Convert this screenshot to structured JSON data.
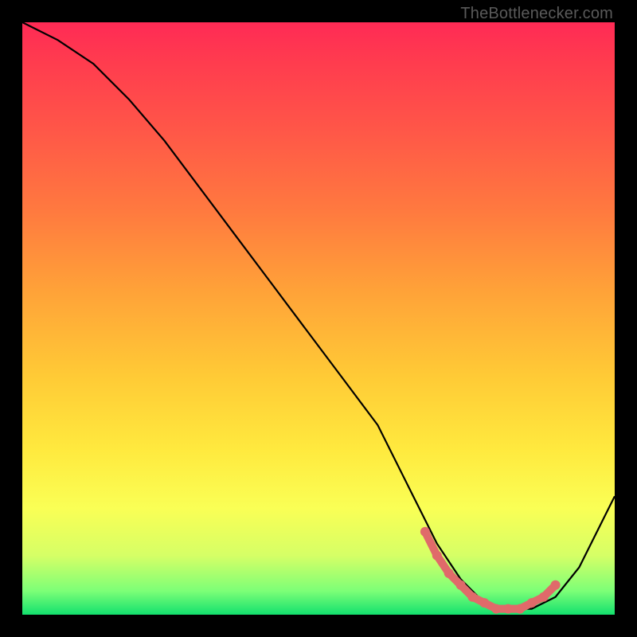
{
  "attribution": "TheBottlenecker.com",
  "chart_data": {
    "type": "line",
    "title": "",
    "xlabel": "",
    "ylabel": "",
    "xlim": [
      0,
      100
    ],
    "ylim": [
      0,
      100
    ],
    "series": [
      {
        "name": "bottleneck-curve",
        "x": [
          0,
          6,
          12,
          18,
          24,
          30,
          36,
          42,
          48,
          54,
          60,
          66,
          70,
          74,
          78,
          82,
          86,
          90,
          94,
          98,
          100
        ],
        "values": [
          100,
          97,
          93,
          87,
          80,
          72,
          64,
          56,
          48,
          40,
          32,
          20,
          12,
          6,
          2,
          1,
          1,
          3,
          8,
          16,
          20
        ]
      },
      {
        "name": "optimal-range-x",
        "x": [
          68,
          70,
          72,
          74,
          76,
          78,
          80,
          82,
          84,
          86,
          88,
          90
        ],
        "values": [
          14,
          10,
          7,
          5,
          3,
          2,
          1,
          1,
          1,
          2,
          3,
          5
        ]
      }
    ],
    "highlight_color": "#e06a6a",
    "curve_color": "#000000"
  }
}
